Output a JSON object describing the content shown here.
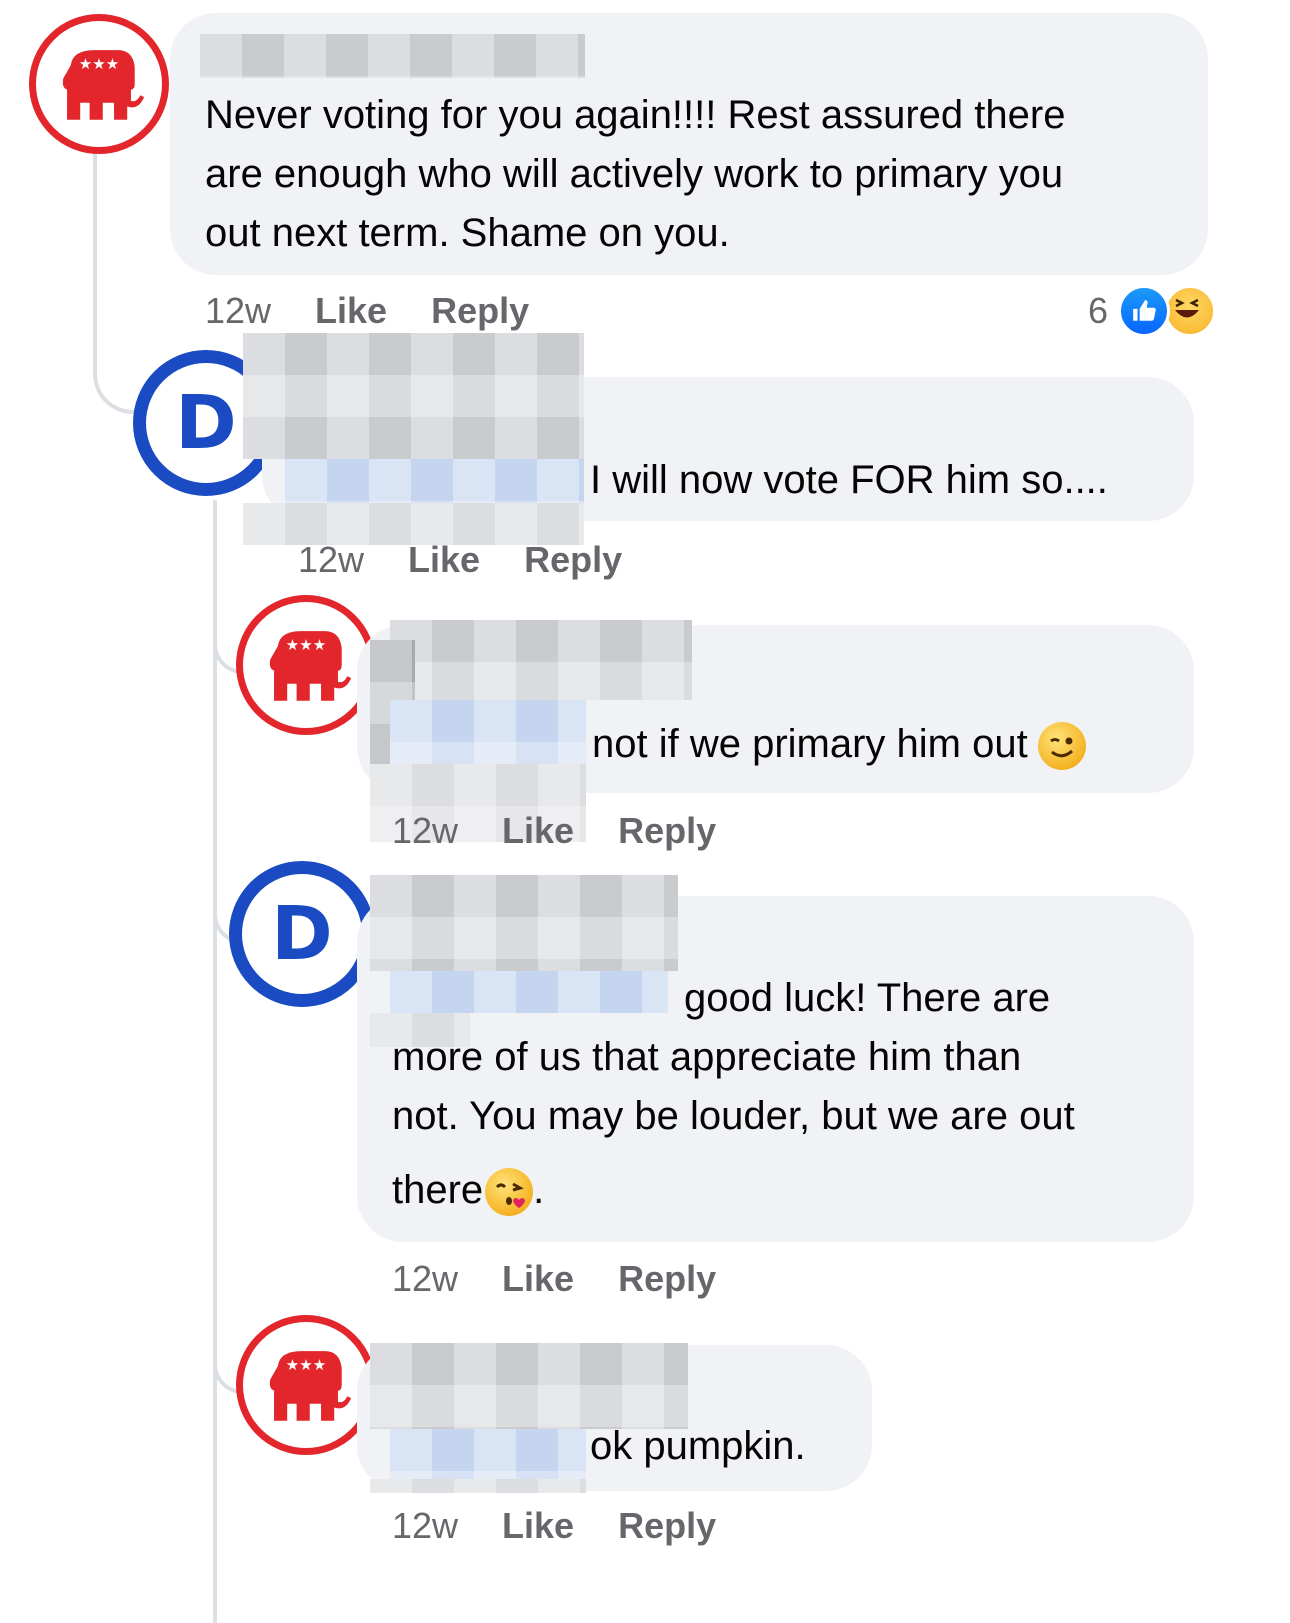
{
  "colors": {
    "republican_red": "#e3262b",
    "democrat_blue": "#1a4bc3",
    "bubble_bg": "#f0f2f5",
    "meta_gray": "#65676b",
    "thread_line": "#dcdfe3"
  },
  "comments": [
    {
      "avatar": "republican-elephant-icon",
      "text_lines": [
        "Never voting for you again!!!! Rest assured there",
        "are enough who will actively work to primary you",
        "out next term.  Shame on you."
      ],
      "time": "12w",
      "like": "Like",
      "reply": "Reply",
      "reaction_count": "6",
      "reaction_icons": [
        "like-reaction-icon",
        "haha-reaction-icon"
      ]
    },
    {
      "avatar": "democrat-d-icon",
      "avatar_letter": "D",
      "text_lines": [
        "I will now vote FOR him so...."
      ],
      "time": "12w",
      "like": "Like",
      "reply": "Reply"
    },
    {
      "avatar": "republican-elephant-icon",
      "text_lines": [
        "not if we primary him out"
      ],
      "emoji": "winking-face-emoji",
      "time": "12w",
      "like": "Like",
      "reply": "Reply"
    },
    {
      "avatar": "democrat-d-icon",
      "avatar_letter": "D",
      "text_lines": [
        "good luck! There are",
        "more of us that appreciate him than",
        "not. You may be louder, but we are out",
        "there"
      ],
      "text_tail": ".",
      "emoji": "face-blowing-kiss-emoji",
      "time": "12w",
      "like": "Like",
      "reply": "Reply"
    },
    {
      "avatar": "republican-elephant-icon",
      "text_lines": [
        "ok pumpkin."
      ],
      "time": "12w",
      "like": "Like",
      "reply": "Reply"
    }
  ]
}
